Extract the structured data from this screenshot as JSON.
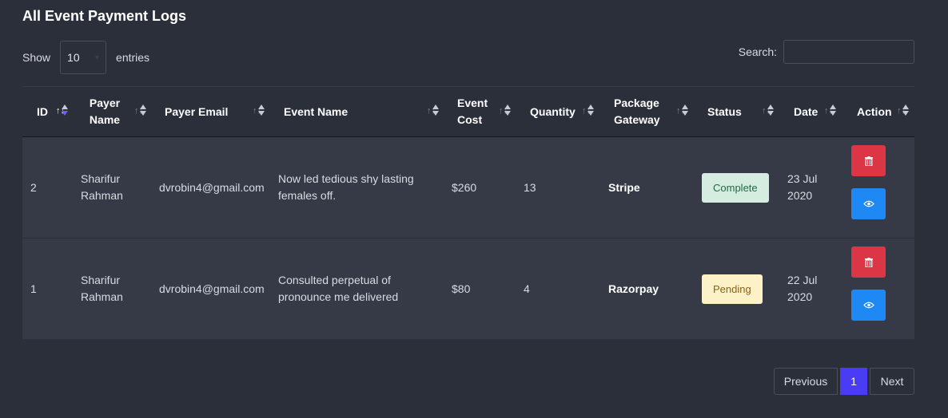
{
  "page": {
    "title": "All Event Payment Logs"
  },
  "length_control": {
    "show_label": "Show",
    "value": "10",
    "entries_label": "entries"
  },
  "search": {
    "label": "Search:",
    "value": ""
  },
  "table": {
    "columns": [
      "ID",
      "Payer Name",
      "Payer Email",
      "Event Name",
      "Event Cost",
      "Quantity",
      "Package Gateway",
      "Status",
      "Date",
      "Action"
    ],
    "rows": [
      {
        "id": "2",
        "payer_name": "Sharifur Rahman",
        "payer_email": "dvrobin4@gmail.com",
        "event_name": "Now led tedious shy lasting females off.",
        "event_cost": "$260",
        "quantity": "13",
        "gateway": "Stripe",
        "status": "Complete",
        "date": "23 Jul 2020"
      },
      {
        "id": "1",
        "payer_name": "Sharifur Rahman",
        "payer_email": "dvrobin4@gmail.com",
        "event_name": "Consulted perpetual of pronounce me delivered",
        "event_cost": "$80",
        "quantity": "4",
        "gateway": "Razorpay",
        "status": "Pending",
        "date": "22 Jul 2020"
      }
    ]
  },
  "pagination": {
    "previous": "Previous",
    "current": "1",
    "next": "Next"
  },
  "colors": {
    "complete": "#d4ede0",
    "pending": "#fdf1c8",
    "delete": "#dc3545",
    "view": "#1e88f5",
    "active_page": "#4a3cf5"
  },
  "icons": {
    "delete": "trash-icon",
    "view": "eye-icon",
    "sort": "sort-icon"
  }
}
